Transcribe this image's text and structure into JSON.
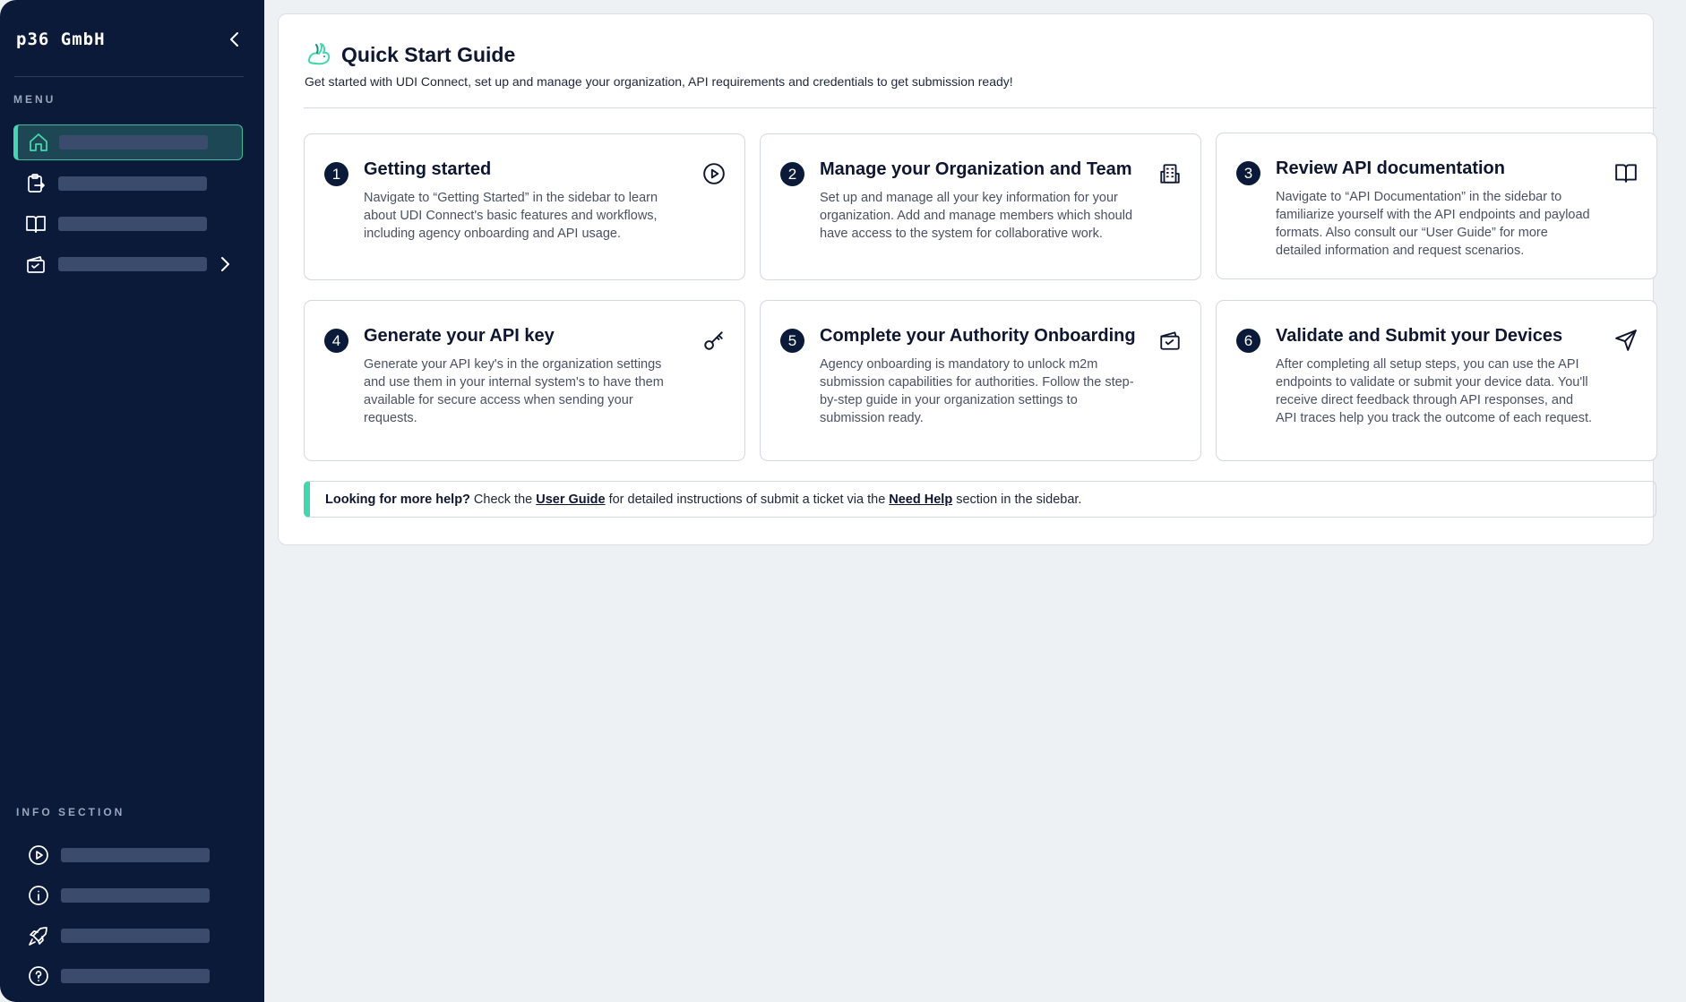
{
  "sidebar": {
    "brand": "p36 GmbH",
    "menu_label": "MENU",
    "info_label": "INFO SECTION",
    "menu_items": [
      {
        "icon": "home-icon",
        "active": true
      },
      {
        "icon": "clipboard-export-icon",
        "active": false
      },
      {
        "icon": "book-icon",
        "active": false
      },
      {
        "icon": "ticket-check-icon",
        "active": false,
        "has_submenu": true
      }
    ],
    "info_items": [
      {
        "icon": "play-circle-icon"
      },
      {
        "icon": "info-circle-icon"
      },
      {
        "icon": "rocket-icon"
      },
      {
        "icon": "help-circle-icon"
      }
    ]
  },
  "main": {
    "title": "Quick Start Guide",
    "subtitle": "Get started with UDI Connect, set up and manage your organization, API requirements and credentials to get submission ready!",
    "steps": [
      {
        "number": "1",
        "title": "Getting started",
        "description": "Navigate to “Getting Started” in the sidebar to learn about UDI Connect's basic features and workflows, including agency onboarding and API usage.",
        "icon": "play-circle-icon"
      },
      {
        "number": "2",
        "title": "Manage your Organization and Team",
        "description": "Set up and manage all your key information for your organization. Add and manage members which should have access to the system for collaborative work.",
        "icon": "building-icon"
      },
      {
        "number": "3",
        "title": "Review API documentation",
        "description": "Navigate to “API Documentation” in the sidebar to familiarize yourself with the API endpoints and payload formats. Also consult our “User Guide” for more detailed information and request scenarios.",
        "icon": "book-open-icon"
      },
      {
        "number": "4",
        "title": "Generate your API key",
        "description": "Generate your API key's in the organization settings and use them in your internal system's to have them available for secure access when sending your requests.",
        "icon": "key-icon"
      },
      {
        "number": "5",
        "title": "Complete your Authority Onboarding",
        "description": "Agency onboarding is mandatory to unlock m2m submission capabilities for authorities. Follow the step-by-step guide in your organization settings to submission ready.",
        "icon": "ticket-check-icon"
      },
      {
        "number": "6",
        "title": "Validate and Submit your Devices",
        "description": "After completing all setup steps, you can use the API endpoints to validate or submit your device data. You'll receive direct feedback through API responses, and API traces help you track the outcome of each request.",
        "icon": "send-icon"
      }
    ],
    "help": {
      "lead": "Looking for more help?",
      "text1": "Check the",
      "link1": "User Guide",
      "text2": "for detailed instructions of submit a ticket via the",
      "link2": "Need Help",
      "text3": "section in the sidebar."
    }
  },
  "colors": {
    "sidebar_bg": "#0b1a38",
    "accent": "#45d6b0",
    "page_bg": "#edf1f4"
  }
}
